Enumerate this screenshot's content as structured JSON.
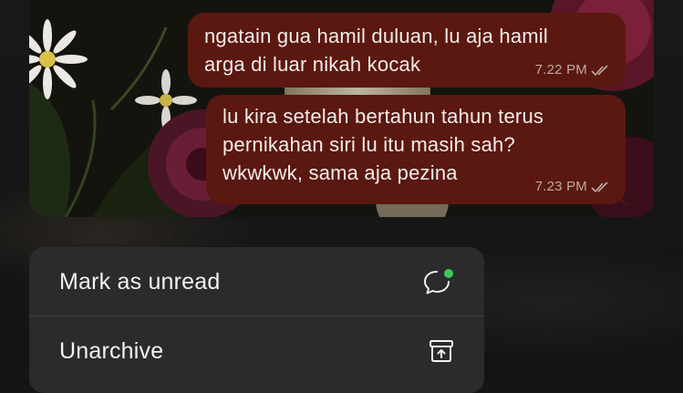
{
  "messages": [
    {
      "text_lines": [
        "ngatain gua hamil duluan, lu aja hamil",
        "arga di luar nikah kocak"
      ],
      "time": "7.22 PM",
      "status": "read-double-check"
    },
    {
      "text_lines": [
        "lu kira setelah bertahun tahun terus",
        "pernikahan siri lu itu masih sah?",
        "wkwkwk, sama aja pezina"
      ],
      "time": "7.23 PM",
      "status": "read-double-check"
    }
  ],
  "context_menu": {
    "items": [
      {
        "label": "Mark as unread",
        "icon": "chat-bubble-unread-icon"
      },
      {
        "label": "Unarchive",
        "icon": "unarchive-box-icon"
      }
    ]
  },
  "colors": {
    "bubble_outgoing": "#5a1810",
    "menu_background": "#2b2b2d",
    "unread_dot": "#3ec65a"
  }
}
